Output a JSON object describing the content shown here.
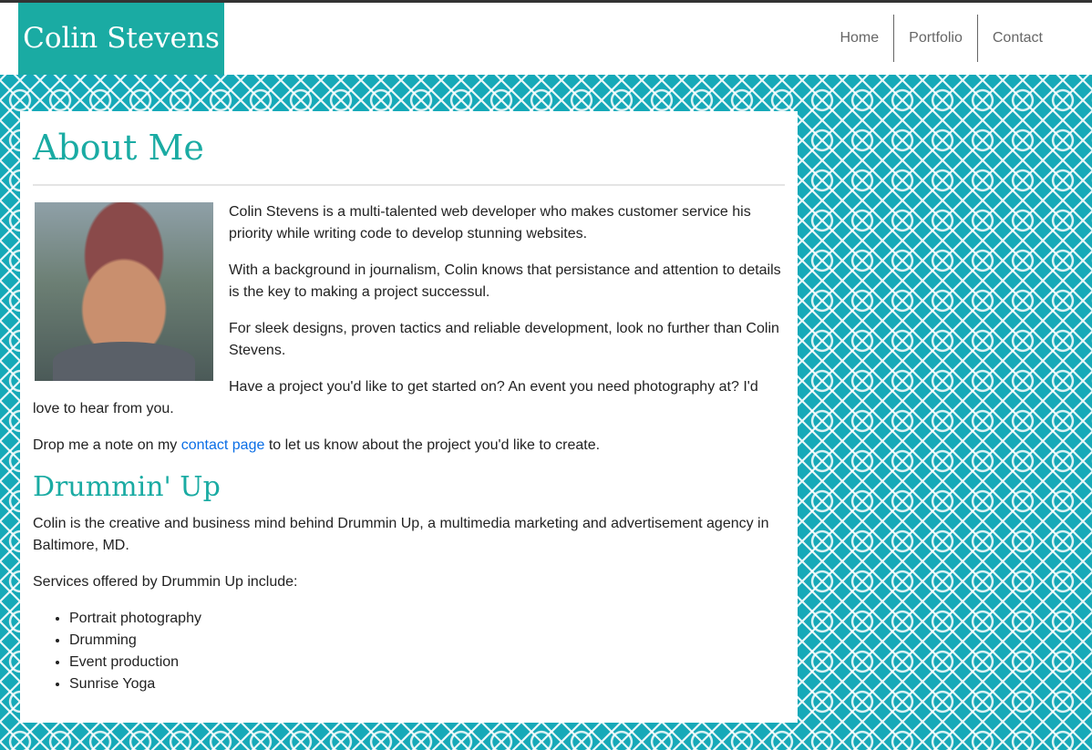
{
  "header": {
    "brand": "Colin Stevens",
    "nav": [
      "Home",
      "Portfolio",
      "Contact"
    ]
  },
  "about": {
    "title": "About Me",
    "paragraphs": [
      "Colin Stevens is a multi-talented web developer who makes customer service his priority while writing code to develop stunning websites.",
      "With a background in journalism, Colin knows that persistance and attention to details is the key to making a project successul.",
      "For sleek designs, proven tactics and reliable development, look no further than Colin Stevens.",
      "Have a project you'd like to get started on? An event you need photography at? I'd love to hear from you."
    ],
    "contact_prefix": "Drop me a note on my ",
    "contact_link": "contact page",
    "contact_suffix": " to let us know about the project you'd like to create."
  },
  "drummin": {
    "title": "Drummin' Up",
    "paragraph": "Colin is the creative and business mind behind Drummin Up, a multimedia marketing and advertisement agency in Baltimore, MD.",
    "services_intro": "Services offered by Drummin Up include:",
    "services": [
      "Portrait photography",
      "Drumming",
      "Event production",
      "Sunrise Yoga"
    ]
  },
  "colors": {
    "brand": "#1aaba3",
    "background_pattern": "#16a9b8",
    "link": "#0a6ee6"
  }
}
